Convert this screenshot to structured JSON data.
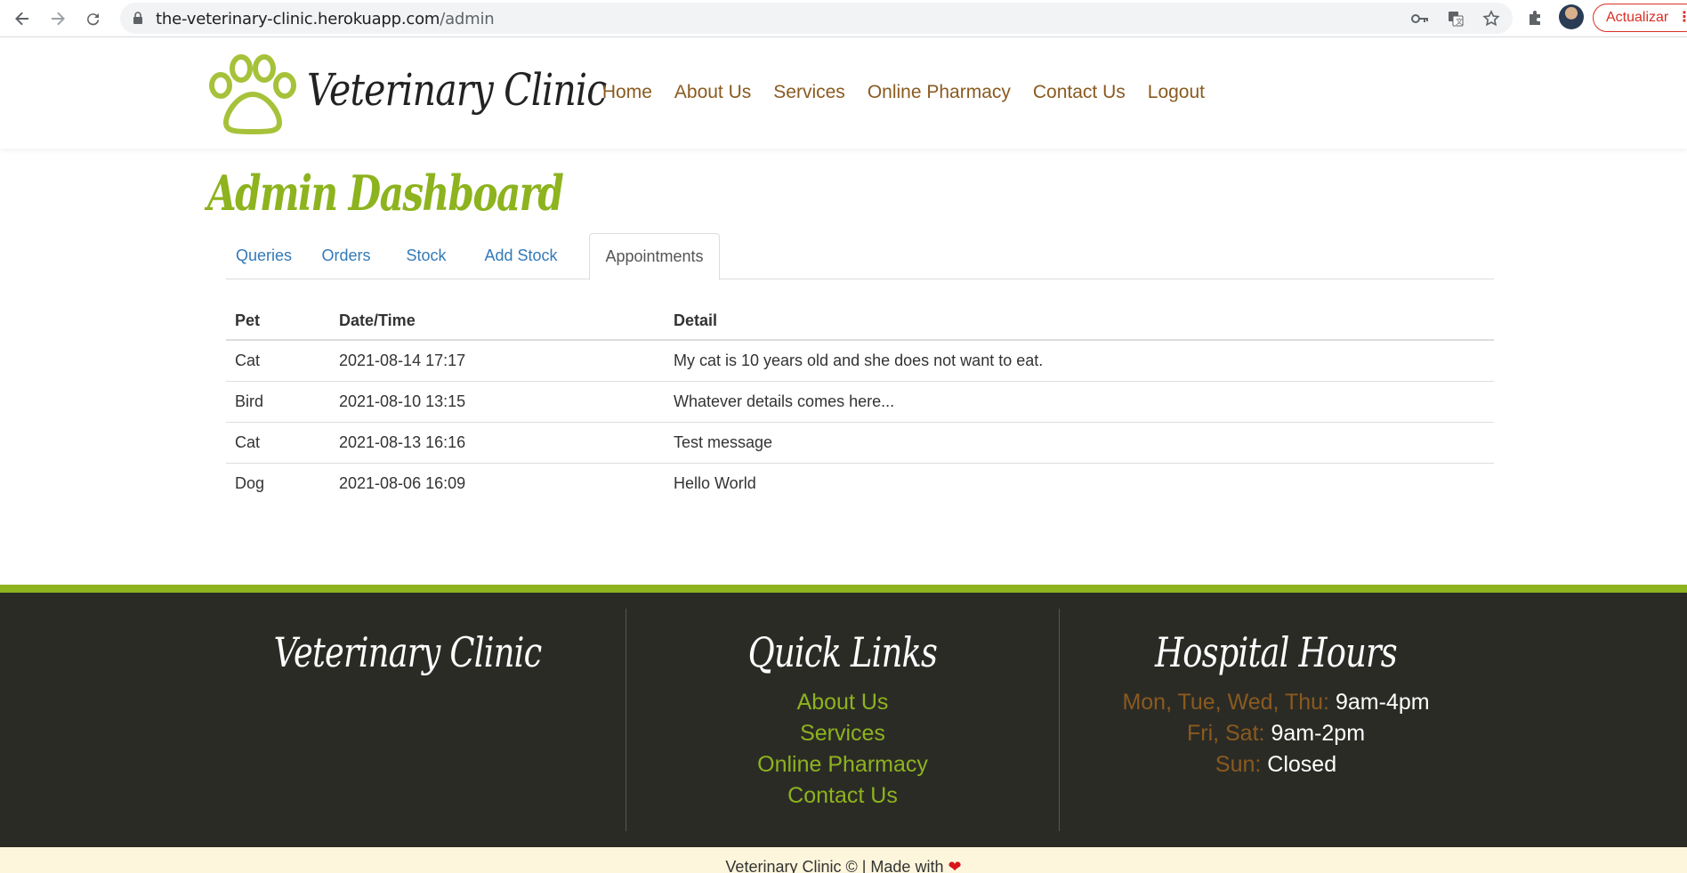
{
  "browser": {
    "url_host": "the-veterinary-clinic.herokuapp.com",
    "url_path": "/admin",
    "update_label": "Actualizar"
  },
  "site": {
    "brand": "Veterinary Clinic",
    "nav": [
      "Home",
      "About Us",
      "Services",
      "Online Pharmacy",
      "Contact Us",
      "Logout"
    ]
  },
  "page": {
    "title": "Admin Dashboard",
    "tabs": [
      "Queries",
      "Orders",
      "Stock",
      "Add Stock",
      "Appointments"
    ],
    "active_tab": "Appointments"
  },
  "appointments": {
    "headers": [
      "Pet",
      "Date/Time",
      "Detail"
    ],
    "rows": [
      [
        "Cat",
        "2021-08-14 17:17",
        "My cat is 10 years old and she does not want to eat."
      ],
      [
        "Bird",
        "2021-08-10 13:15",
        "Whatever details comes here..."
      ],
      [
        "Cat",
        "2021-08-13 16:16",
        "Test message"
      ],
      [
        "Dog",
        "2021-08-06 16:09",
        "Hello World"
      ]
    ]
  },
  "footer": {
    "brand": "Veterinary Clinic",
    "quick_links_title": "Quick Links",
    "quick_links": [
      "About Us",
      "Services",
      "Online Pharmacy",
      "Contact Us"
    ],
    "hours_title": "Hospital Hours",
    "hours": [
      {
        "days": "Mon, Tue, Wed, Thu:",
        "time": "9am-4pm"
      },
      {
        "days": "Fri, Sat:",
        "time": "9am-2pm"
      },
      {
        "days": "Sun:",
        "time": "Closed"
      }
    ],
    "copyright": "Veterinary Clinic © | Made with"
  },
  "colors": {
    "accent_green": "#8db31e",
    "nav_brown": "#8a5a1f",
    "footer_bg": "#2b2b26",
    "link_blue": "#337ab7"
  }
}
